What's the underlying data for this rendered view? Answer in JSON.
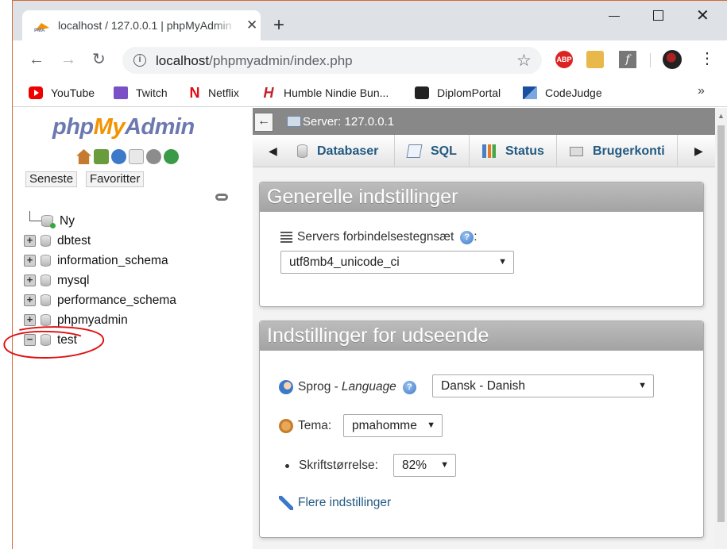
{
  "browser": {
    "tab_title": "localhost / 127.0.0.1 | phpMyAdmin",
    "new_tab": "+",
    "close_tab": "✕",
    "url_host": "localhost",
    "url_path": "/phpmyadmin/index.php",
    "abp_label": "ABP",
    "ext3_label": "f",
    "overflow": "»"
  },
  "bookmarks": [
    {
      "label": "YouTube",
      "icon": "youtube-icon"
    },
    {
      "label": "Twitch",
      "icon": "twitch-icon"
    },
    {
      "label": "Netflix",
      "icon": "netflix-icon"
    },
    {
      "label": "Humble Nindie Bun...",
      "icon": "humble-icon"
    },
    {
      "label": "DiplomPortal",
      "icon": "react-icon"
    },
    {
      "label": "CodeJudge",
      "icon": "codejudge-icon"
    }
  ],
  "nav": {
    "logo_php": "php",
    "logo_my": "My",
    "logo_admin": "Admin",
    "recent": "Seneste",
    "favorites": "Favoritter",
    "new_label": "Ny",
    "databases": [
      "dbtest",
      "information_schema",
      "mysql",
      "performance_schema",
      "phpmyadmin",
      "test"
    ]
  },
  "content": {
    "back": "←",
    "server_label": "Server: 127.0.0.1",
    "tabs": [
      "Databaser",
      "SQL",
      "Status",
      "Brugerkonti"
    ],
    "general": {
      "title": "Generelle indstillinger",
      "charset_label": "Servers forbindelsestegnsæt",
      "charset_value": "utf8mb4_unicode_ci"
    },
    "appearance": {
      "title": "Indstillinger for udseende",
      "language_label": "Sprog - ",
      "language_label_em": "Language",
      "language_value": "Dansk - Danish",
      "theme_label": "Tema:",
      "theme_value": "pmahomme",
      "font_size_label": "Skriftstørrelse:",
      "font_size_value": "82%",
      "more_settings": "Flere indstillinger"
    }
  },
  "colors": {
    "link_blue": "#235a81",
    "logo_blue": "#6c78af",
    "logo_orange": "#f29400",
    "annotation_red": "#e01010"
  }
}
